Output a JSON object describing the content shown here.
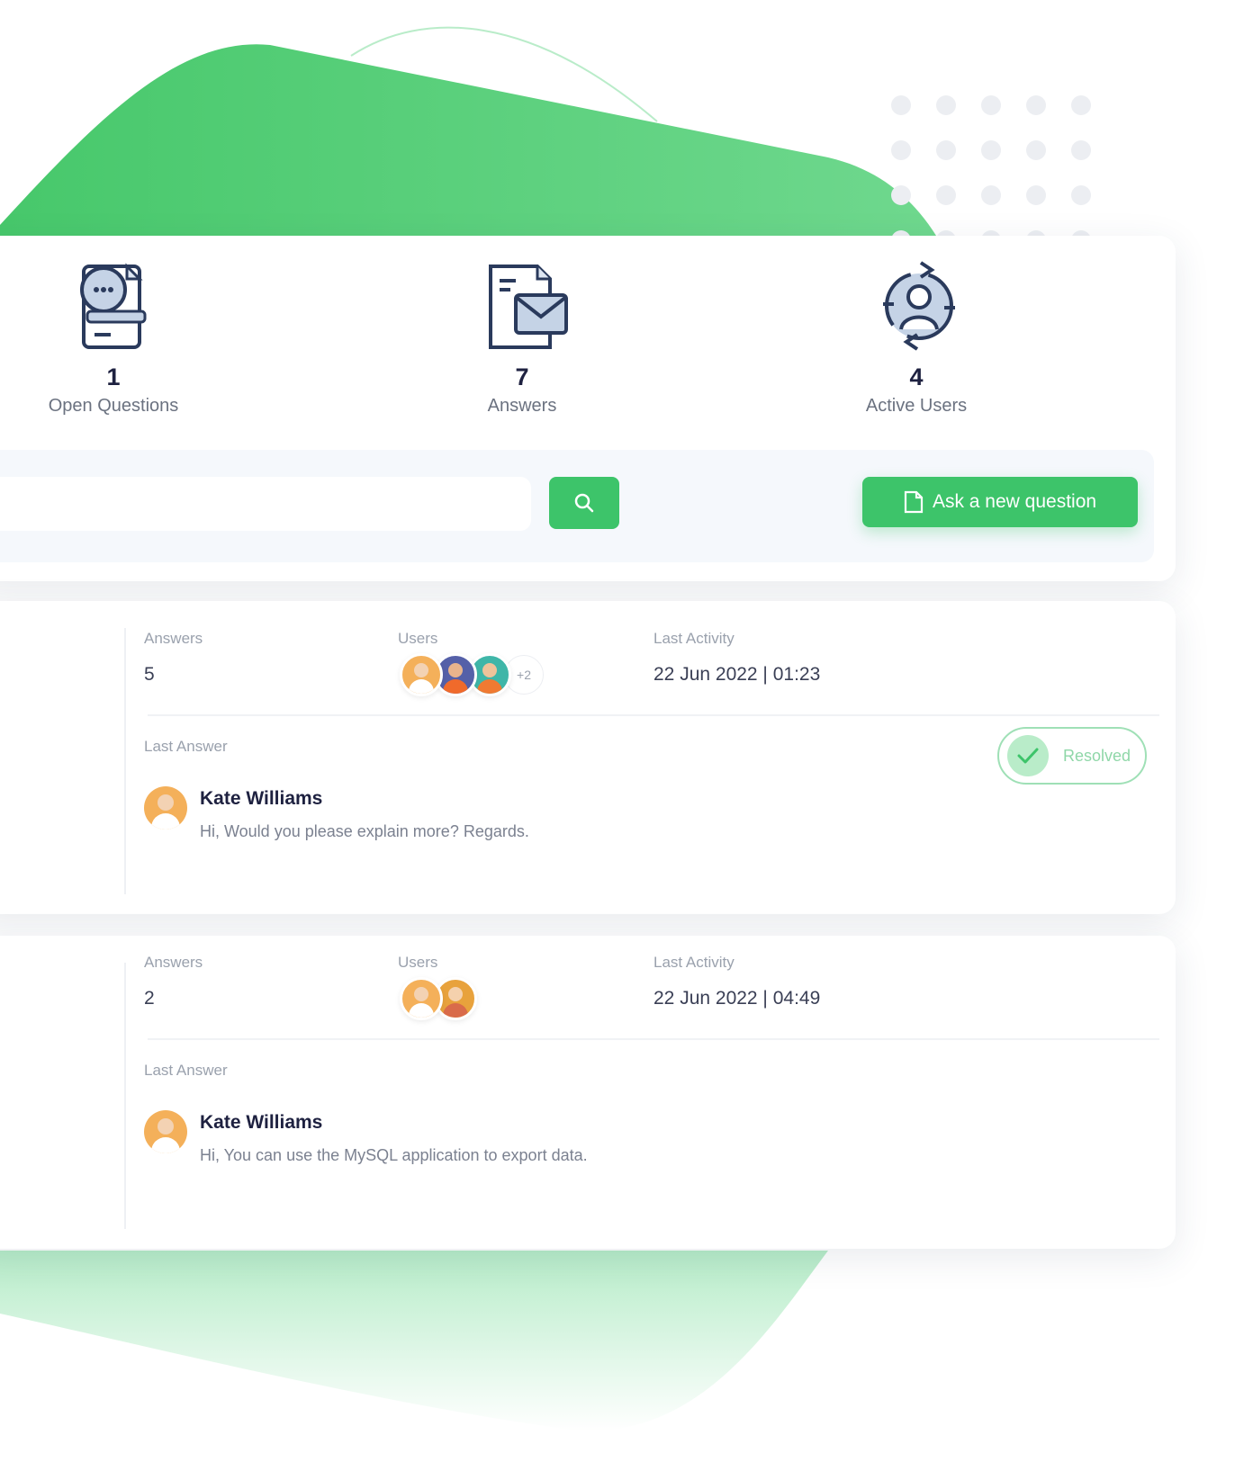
{
  "colors": {
    "accent_green": "#3dc46a",
    "dark_navy": "#1e2140",
    "muted_text": "#9aa1ad",
    "resolved_green": "#9fe0b6"
  },
  "stats": [
    {
      "icon": "open-questions-icon",
      "value": "1",
      "label": "Open Questions"
    },
    {
      "icon": "answers-envelope-icon",
      "value": "7",
      "label": "Answers"
    },
    {
      "icon": "active-users-icon",
      "value": "4",
      "label": "Active Users"
    }
  ],
  "search": {
    "placeholder": "",
    "button_icon": "search-icon"
  },
  "ask_button": {
    "icon": "document-icon",
    "label": "Ask a new question"
  },
  "questions": [
    {
      "answers_label": "Answers",
      "answers_value": "5",
      "users_label": "Users",
      "users_more": "+2",
      "last_activity_label": "Last Activity",
      "last_activity_value": "22 Jun 2022 | 01:23",
      "last_answer_label": "Last Answer",
      "last_answer_author": "Kate Williams",
      "last_answer_text": "Hi, Would you please explain more? Regards.",
      "status": "Resolved"
    },
    {
      "answers_label": "Answers",
      "answers_value": "2",
      "users_label": "Users",
      "last_activity_label": "Last Activity",
      "last_activity_value": "22 Jun 2022 | 04:49",
      "last_answer_label": "Last Answer",
      "last_answer_author": "Kate Williams",
      "last_answer_text": "Hi, You can use the MySQL application to export data."
    }
  ]
}
